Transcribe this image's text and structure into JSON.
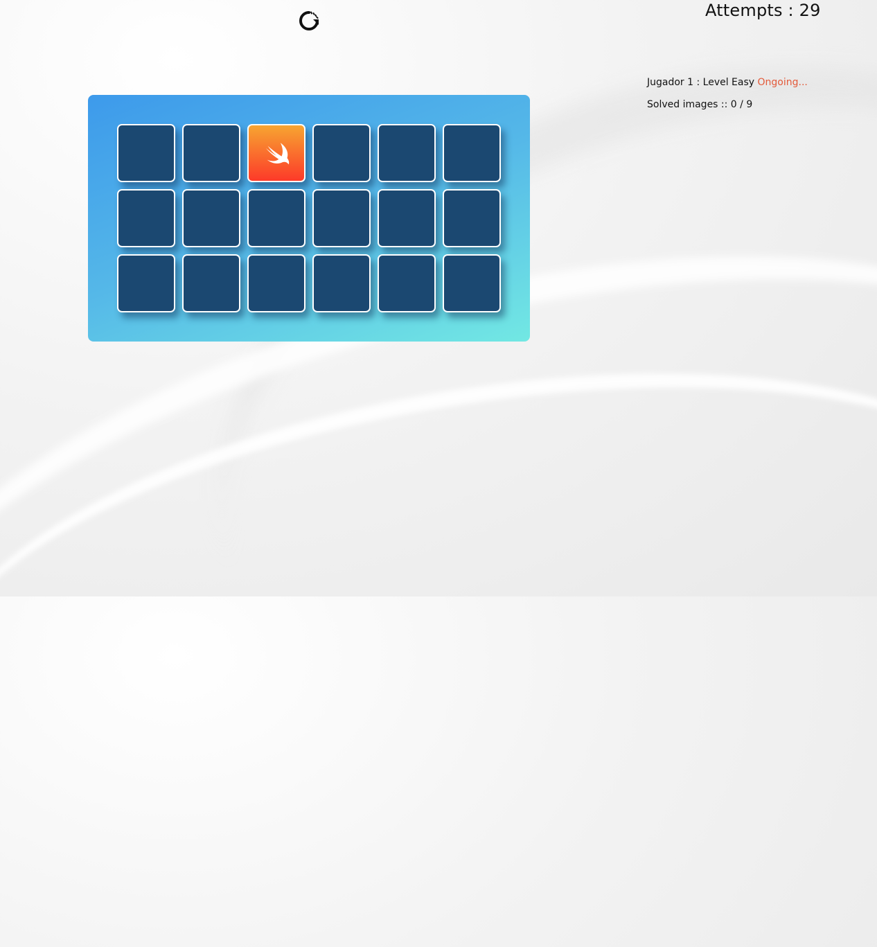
{
  "header": {
    "restart_icon": "restart-icon",
    "attempts_text": "Attempts : 29"
  },
  "status": {
    "player_level": "Jugador 1 : Level Easy ",
    "state": "Ongoing...",
    "solved": "Solved images :: 0 / 9"
  },
  "board": {
    "rows": 3,
    "cols": 6,
    "cards": [
      {
        "state": "hidden"
      },
      {
        "state": "hidden"
      },
      {
        "state": "revealed",
        "icon": "swift-logo-icon"
      },
      {
        "state": "hidden"
      },
      {
        "state": "hidden"
      },
      {
        "state": "hidden"
      },
      {
        "state": "hidden"
      },
      {
        "state": "hidden"
      },
      {
        "state": "hidden"
      },
      {
        "state": "hidden"
      },
      {
        "state": "hidden"
      },
      {
        "state": "hidden"
      },
      {
        "state": "hidden"
      },
      {
        "state": "hidden"
      },
      {
        "state": "hidden"
      },
      {
        "state": "hidden"
      },
      {
        "state": "hidden"
      },
      {
        "state": "hidden"
      }
    ],
    "colors": {
      "card_back": "#1b4871",
      "card_border": "#ffffff",
      "revealed_top": "#f7a531",
      "revealed_bottom": "#fd3a29",
      "board_start": "#3d9aeb",
      "board_end": "#72e8e3",
      "ongoing": "#e35a3a"
    }
  }
}
